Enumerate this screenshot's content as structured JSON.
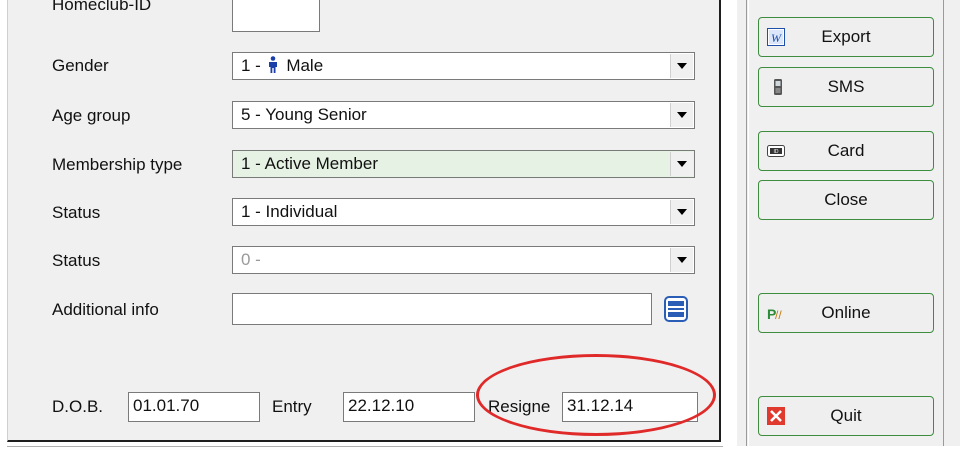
{
  "form": {
    "homeclub_label": "Homeclub-ID",
    "gender_label": "Gender",
    "gender_value_prefix": "1 -",
    "gender_value_text": "Male",
    "agegroup_label": "Age group",
    "agegroup_value": "5 - Young Senior",
    "membership_label": "Membership type",
    "membership_value": "1 - Active Member",
    "status1_label": "Status",
    "status1_value": "1 - Individual",
    "status2_label": "Status",
    "status2_value": "0 -",
    "additional_label": "Additional info",
    "additional_value": "",
    "dob_label": "D.O.B.",
    "dob_value": "01.01.70",
    "entry_label": "Entry",
    "entry_value": "22.12.10",
    "resigned_label": "Resigne",
    "resigned_value": "31.12.14"
  },
  "buttons": {
    "export": "Export",
    "sms": "SMS",
    "card": "Card",
    "close": "Close",
    "online": "Online",
    "quit": "Quit"
  },
  "icons": {
    "gender": "male-person-icon",
    "additional": "edit-icon",
    "export": "word-doc-icon",
    "sms": "phone-icon",
    "card": "id-card-icon",
    "online": "online-icon",
    "quit": "quit-icon"
  },
  "colors": {
    "highlight_ellipse": "#e02a2a",
    "button_border": "#3e8d3e",
    "membership_bg": "#e6f2e3"
  }
}
